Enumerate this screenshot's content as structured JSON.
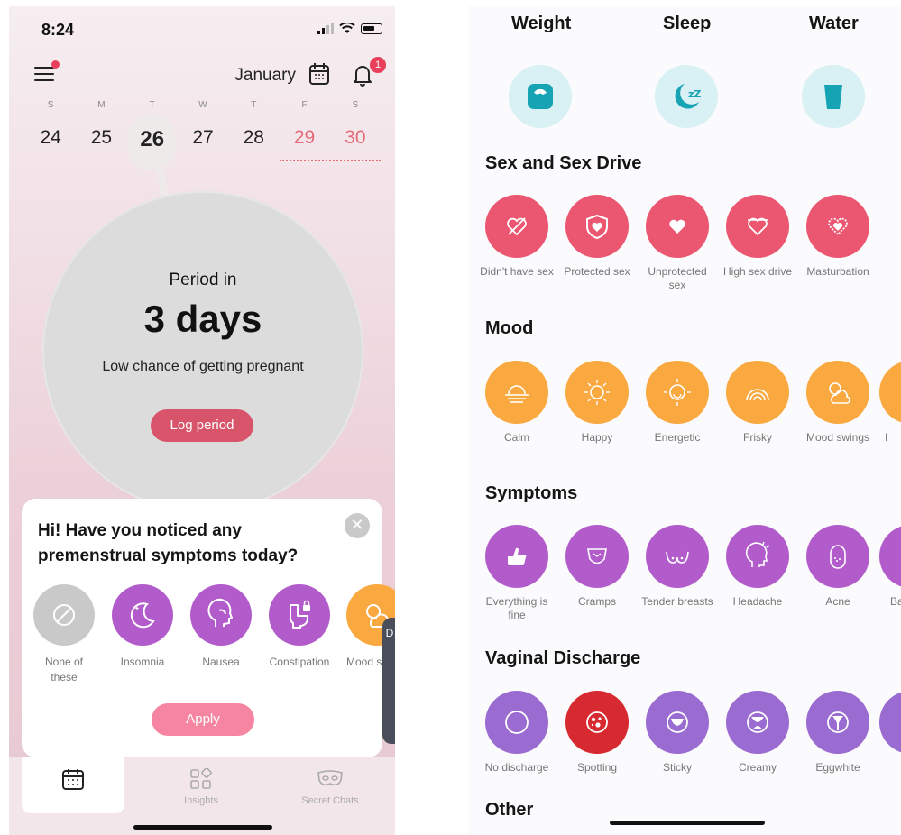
{
  "phone_left": {
    "status": {
      "time": "8:24"
    },
    "header": {
      "month": "January",
      "notification_count": "1"
    },
    "week": {
      "day_letters": [
        "S",
        "M",
        "T",
        "W",
        "T",
        "F",
        "S"
      ],
      "dates": [
        "24",
        "25",
        "26",
        "27",
        "28",
        "29",
        "30"
      ],
      "today_index": 2,
      "predicted_period_indices": [
        5,
        6
      ]
    },
    "circle": {
      "title": "Period in",
      "value": "3 days",
      "subtitle": "Low chance of getting pregnant",
      "log_button": "Log period"
    },
    "prompt_card": {
      "question": "Hi! Have you noticed any premenstrual symptoms today?",
      "options": [
        {
          "label": "None of these",
          "icon": "slash-circle-icon",
          "color": "#c9c9c9"
        },
        {
          "label": "Insomnia",
          "icon": "moon-stars-icon",
          "color": "#b25ccb"
        },
        {
          "label": "Nausea",
          "icon": "head-profile-icon",
          "color": "#b25ccb"
        },
        {
          "label": "Constipation",
          "icon": "toilet-lock-icon",
          "color": "#b25ccb"
        },
        {
          "label": "Mood swings",
          "icon": "sun-cloud-icon",
          "color": "#f9a93f"
        }
      ],
      "apply_button": "Apply",
      "peek_letter": "D"
    },
    "tabs": [
      {
        "label": "",
        "icon": "calendar-icon"
      },
      {
        "label": "Insights",
        "icon": "grid-diamond-icon"
      },
      {
        "label": "Secret Chats",
        "icon": "mask-icon"
      }
    ]
  },
  "phone_right": {
    "tracking": [
      {
        "label": "Weight",
        "icon": "scale-icon"
      },
      {
        "label": "Sleep",
        "icon": "moon-zz-icon"
      },
      {
        "label": "Water",
        "icon": "glass-icon"
      }
    ],
    "sections": [
      {
        "title": "Sex and Sex Drive",
        "color": "#eb5670",
        "items": [
          "Didn't have sex",
          "Protected sex",
          "Unprotected sex",
          "High sex drive",
          "Masturbation"
        ]
      },
      {
        "title": "Mood",
        "color": "#f9a93f",
        "items": [
          "Calm",
          "Happy",
          "Energetic",
          "Frisky",
          "Mood swings",
          "I"
        ]
      },
      {
        "title": "Symptoms",
        "color": "#b25ccb",
        "items": [
          "Everything is fine",
          "Cramps",
          "Tender breasts",
          "Headache",
          "Acne",
          "Ba"
        ]
      },
      {
        "title": "Vaginal Discharge",
        "color": "#9a6bd0",
        "items": [
          "No discharge",
          "Spotting",
          "Sticky",
          "Creamy",
          "Eggwhite",
          ""
        ]
      },
      {
        "title": "Other",
        "color": "#888888",
        "items": []
      }
    ]
  }
}
